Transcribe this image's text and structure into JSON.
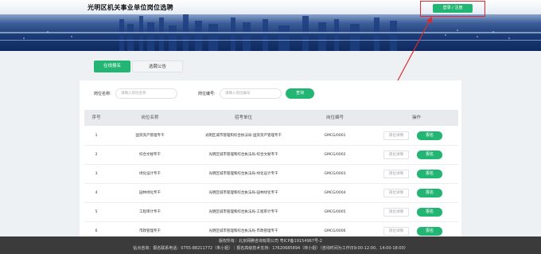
{
  "header": {
    "title": "光明区机关事业单位岗位选聘",
    "login_label": "登录 / 注册"
  },
  "tabs": [
    {
      "label": "在线报名"
    },
    {
      "label": "选聘公告"
    }
  ],
  "search": {
    "name_label": "岗位名称:",
    "name_placeholder": "请输入岗位名称",
    "code_label": "岗位编号:",
    "code_placeholder": "请输入岗位编号",
    "query_label": "查询"
  },
  "table": {
    "columns": [
      "序号",
      "岗位名称",
      "招考单位",
      "岗位编号",
      "操作"
    ],
    "detail_label": "岗位详情",
    "apply_label": "报名",
    "rows": [
      {
        "no": "1",
        "name": "国资资产管理专干",
        "unit": "光明区城市管理和综合执法局-国资资产管理专干",
        "code": "GMCG/0001"
      },
      {
        "no": "2",
        "name": "综合文秘专干",
        "unit": "光明区城市管理和综合执法局-综合文秘专干",
        "code": "GMCG/0002"
      },
      {
        "no": "3",
        "name": "绿化设计专干",
        "unit": "光明区城市管理和综合执法局-绿化设计专干",
        "code": "GMCG/0003"
      },
      {
        "no": "4",
        "name": "园林绿化专干",
        "unit": "光明区城市管理和综合执法局-园林绿化专干",
        "code": "GMCG/0004"
      },
      {
        "no": "5",
        "name": "工程审计专干",
        "unit": "光明区城市管理和综合执法局-工程审计专干",
        "code": "GMCG/0005"
      },
      {
        "no": "6",
        "name": "市政管理专干",
        "unit": "光明区城市管理和综合执法局-市政管理专干",
        "code": "GMCG/0006"
      }
    ]
  },
  "footer": {
    "line1": "版权所有：北京网腾咨询有限公司 粤ICP备19154967号-2",
    "line2": "钻点咨询：报名联系电话：0755-88211772（朱小姐）｜报名高级技术支持：17620685894（林小姐）（咨询时间为工作日9:00-12:00、14:00-18:00）"
  },
  "colors": {
    "accent": "#22b573",
    "highlight": "#e02a2a",
    "footer_bg": "#3b3b3b"
  }
}
